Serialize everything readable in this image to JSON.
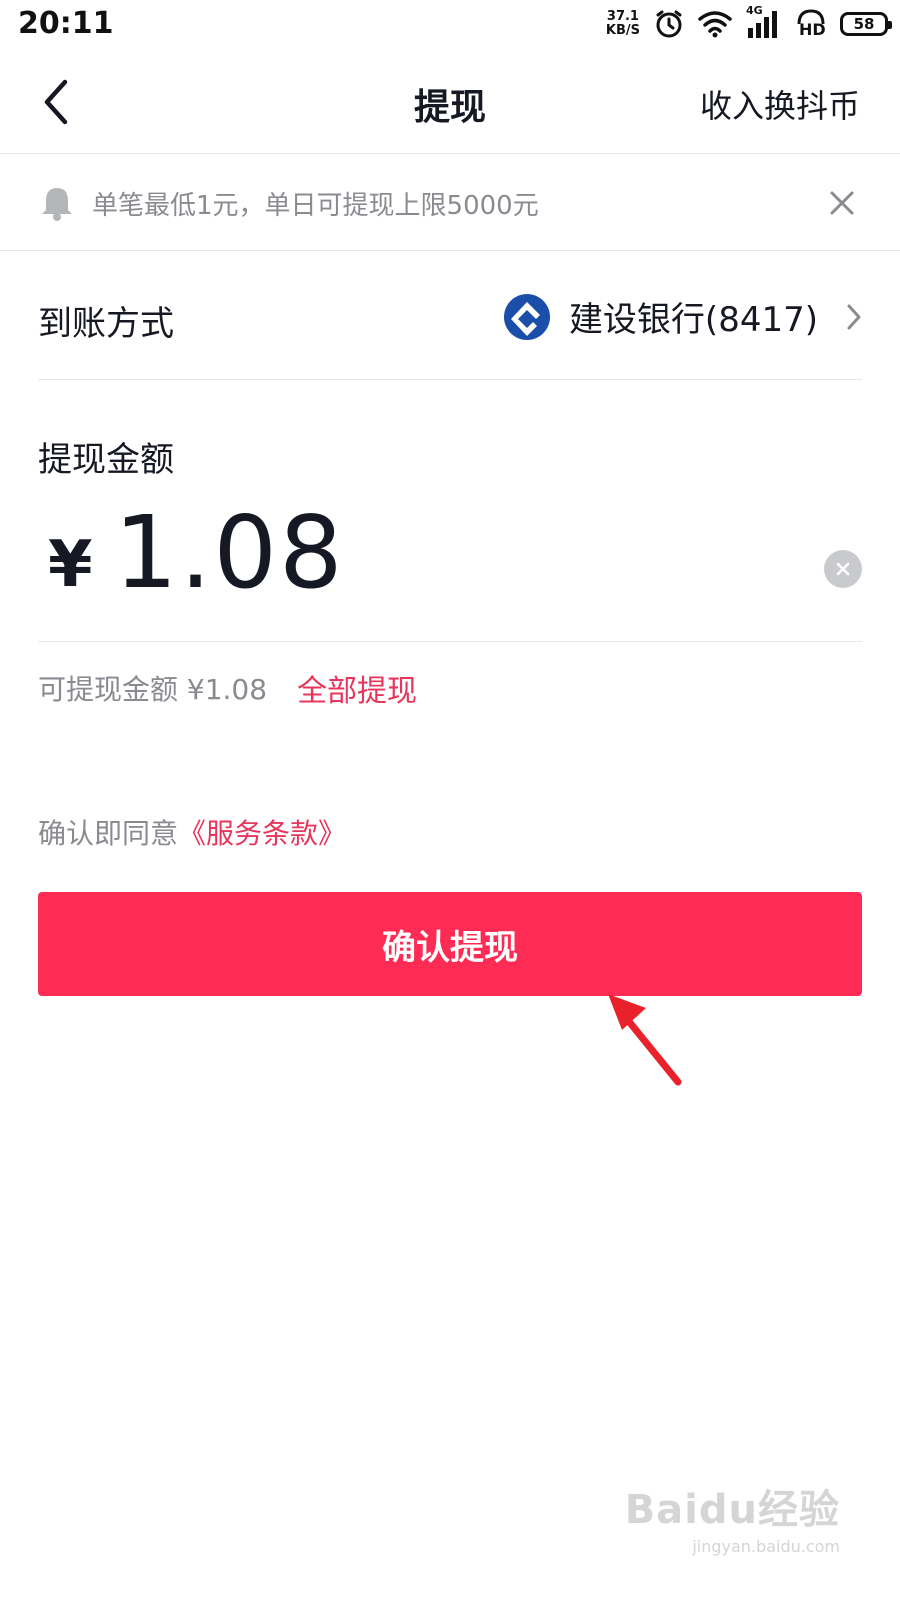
{
  "status_bar": {
    "time": "20:11",
    "speed_value": "37.1",
    "speed_unit": "KB/S",
    "network": "4G",
    "hd": "HD",
    "battery": "58"
  },
  "nav": {
    "title": "提现",
    "action_label": "收入换抖币"
  },
  "notice": {
    "text": "单笔最低1元，单日可提现上限5000元"
  },
  "payout": {
    "label": "到账方式",
    "bank": "建设银行(8417)"
  },
  "amount": {
    "label": "提现金额",
    "currency": "¥",
    "value": "1.08"
  },
  "available": {
    "text": "可提现金额 ¥1.08",
    "withdraw_all": "全部提现"
  },
  "agreement": {
    "prefix": "确认即同意",
    "terms_link": "《服务条款》"
  },
  "confirm_button": "确认提现",
  "watermark": {
    "logo": "Baidu经验",
    "url": "jingyan.baidu.com"
  },
  "colors": {
    "accent": "#fe2c55",
    "link": "#e8355c",
    "bank_logo": "#1a4ea8",
    "annotation_arrow": "#e8212b"
  }
}
